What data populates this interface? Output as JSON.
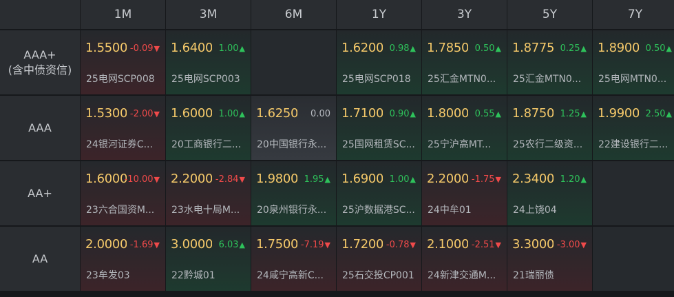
{
  "headers": [
    "1M",
    "3M",
    "6M",
    "1Y",
    "3Y",
    "5Y",
    "7Y"
  ],
  "rows": [
    {
      "label_line1": "AAA+",
      "label_line2": "(含中债资信)",
      "cells": [
        {
          "price": "1.5500",
          "change": "-0.09",
          "dir": "down",
          "name": "25电网SCP008"
        },
        {
          "price": "1.6400",
          "change": "1.00",
          "dir": "up",
          "name": "25电网SCP003"
        },
        null,
        {
          "price": "1.6200",
          "change": "0.98",
          "dir": "up",
          "name": "25电网SCP018"
        },
        {
          "price": "1.7850",
          "change": "0.50",
          "dir": "up",
          "name": "25汇金MTN0..."
        },
        {
          "price": "1.8775",
          "change": "0.25",
          "dir": "up",
          "name": "25汇金MTN0..."
        },
        {
          "price": "1.8900",
          "change": "0.50",
          "dir": "up",
          "name": "25电网MTN0..."
        }
      ]
    },
    {
      "label_line1": "AAA",
      "label_line2": "",
      "cells": [
        {
          "price": "1.5300",
          "change": "-2.00",
          "dir": "down",
          "name": "24银河证券C..."
        },
        {
          "price": "1.6000",
          "change": "1.00",
          "dir": "up",
          "name": "20工商银行二..."
        },
        {
          "price": "1.6250",
          "change": "0.00",
          "dir": "flat",
          "name": "20中国银行永..."
        },
        {
          "price": "1.7100",
          "change": "0.90",
          "dir": "up",
          "name": "25国网租赁SC..."
        },
        {
          "price": "1.8000",
          "change": "0.55",
          "dir": "up",
          "name": "25宁沪高MT..."
        },
        {
          "price": "1.8750",
          "change": "1.25",
          "dir": "up",
          "name": "25农行二级资..."
        },
        {
          "price": "1.9900",
          "change": "2.50",
          "dir": "up",
          "name": "22建设银行二..."
        }
      ]
    },
    {
      "label_line1": "AA+",
      "label_line2": "",
      "cells": [
        {
          "price": "1.6000",
          "change": "-10.00",
          "dir": "down",
          "name": "23六合国资M..."
        },
        {
          "price": "2.2000",
          "change": "-2.84",
          "dir": "down",
          "name": "23水电十局M..."
        },
        {
          "price": "1.9800",
          "change": "1.95",
          "dir": "up",
          "name": "20泉州银行永..."
        },
        {
          "price": "1.6900",
          "change": "1.00",
          "dir": "up",
          "name": "25沪数据港SC..."
        },
        {
          "price": "2.2000",
          "change": "-1.75",
          "dir": "down",
          "name": "24中牟01"
        },
        {
          "price": "2.3400",
          "change": "1.20",
          "dir": "up",
          "name": "24上饶04"
        },
        null
      ]
    },
    {
      "label_line1": "AA",
      "label_line2": "",
      "cells": [
        {
          "price": "2.0000",
          "change": "-1.69",
          "dir": "down",
          "name": "23牟发03"
        },
        {
          "price": "3.0000",
          "change": "6.03",
          "dir": "up",
          "name": "22黔城01"
        },
        {
          "price": "1.7500",
          "change": "-7.19",
          "dir": "down",
          "name": "24咸宁高新C..."
        },
        {
          "price": "1.7200",
          "change": "-0.78",
          "dir": "down",
          "name": "25石交投CP001"
        },
        {
          "price": "2.1000",
          "change": "-2.51",
          "dir": "down",
          "name": "24新津交通M..."
        },
        {
          "price": "3.3000",
          "change": "-3.00",
          "dir": "down",
          "name": "21瑞丽债"
        },
        null
      ]
    }
  ],
  "colors": {
    "up": "#2ec25b",
    "down": "#f04a4a",
    "price": "#f5c96a"
  },
  "icons": {
    "up": "▲",
    "down": "▼"
  }
}
